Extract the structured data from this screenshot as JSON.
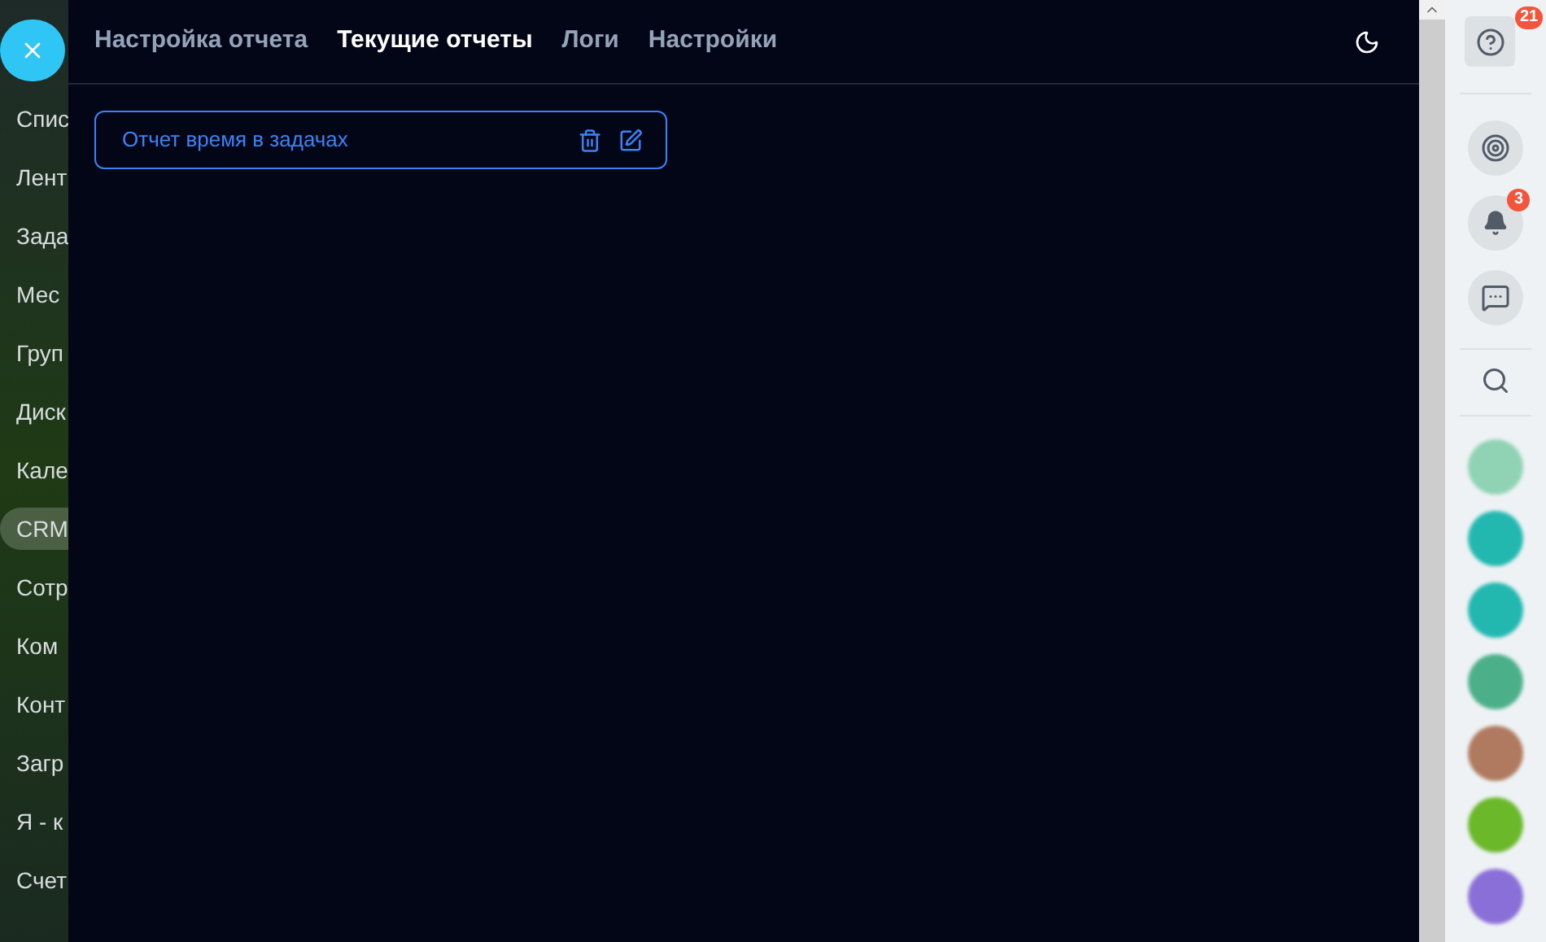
{
  "left_menu": {
    "items": [
      {
        "label": "Спис",
        "selected": false
      },
      {
        "label": "Лент",
        "selected": false
      },
      {
        "label": "Зада",
        "selected": false
      },
      {
        "label": "Мес",
        "selected": false
      },
      {
        "label": "Груп",
        "selected": false
      },
      {
        "label": "Диск",
        "selected": false
      },
      {
        "label": "Кале",
        "selected": false
      },
      {
        "label": "CRM",
        "selected": true
      },
      {
        "label": "Сотр",
        "selected": false
      },
      {
        "label": "Ком",
        "selected": false
      },
      {
        "label": "Конт",
        "selected": false
      },
      {
        "label": "Загр",
        "selected": false
      },
      {
        "label": "Я - к",
        "selected": false
      },
      {
        "label": "Счет",
        "selected": false
      }
    ]
  },
  "tabs": [
    {
      "label": "Настройка отчета",
      "selected": false
    },
    {
      "label": "Текущие отчеты",
      "selected": true
    },
    {
      "label": "Логи",
      "selected": false
    },
    {
      "label": "Настройки",
      "selected": false
    }
  ],
  "reports": [
    {
      "title": "Отчет время в задачах"
    }
  ],
  "right_bar": {
    "help_badge": "21",
    "notification_badge": "3",
    "avatars": [
      {
        "color": "#8fd3b4"
      },
      {
        "color": "#22b8b0"
      },
      {
        "color": "#22b8b0"
      },
      {
        "color": "#4bb08a"
      },
      {
        "color": "#b07a60"
      },
      {
        "color": "#6bb82a"
      },
      {
        "color": "#8a6fd8"
      }
    ]
  }
}
